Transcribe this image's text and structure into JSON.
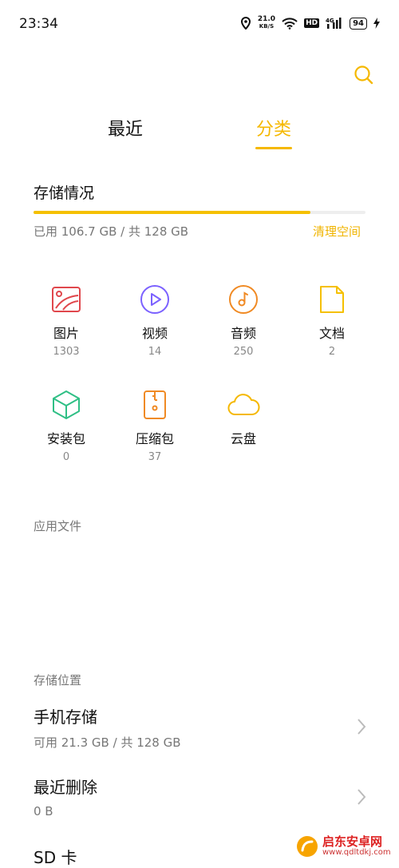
{
  "status_bar": {
    "time": "23:34",
    "speed_value": "21.0",
    "speed_unit": "KB/S",
    "hd": "HD",
    "battery": "94"
  },
  "header": {
    "tabs": [
      {
        "label": "最近"
      },
      {
        "label": "分类"
      }
    ],
    "accent_color": "#f5b800"
  },
  "storage": {
    "title": "存储情况",
    "usage_text": "已用 106.7 GB / 共 128 GB",
    "used_fraction": 0.834,
    "clean_label": "清理空间"
  },
  "categories": [
    {
      "label": "图片",
      "count": "1303",
      "icon": "image-icon",
      "color": "#e0474c"
    },
    {
      "label": "视频",
      "count": "14",
      "icon": "video-icon",
      "color": "#7b61ff"
    },
    {
      "label": "音频",
      "count": "250",
      "icon": "audio-icon",
      "color": "#f08a24"
    },
    {
      "label": "文档",
      "count": "2",
      "icon": "document-icon",
      "color": "#f5c000"
    },
    {
      "label": "安装包",
      "count": "0",
      "icon": "package-icon",
      "color": "#2fbf85"
    },
    {
      "label": "压缩包",
      "count": "37",
      "icon": "archive-icon",
      "color": "#f08a24"
    },
    {
      "label": "云盘",
      "count": "",
      "icon": "cloud-icon",
      "color": "#f5b800"
    }
  ],
  "app_files": {
    "title": "应用文件"
  },
  "storage_locations": {
    "title": "存储位置",
    "items": [
      {
        "title": "手机存储",
        "subtitle": "可用 21.3 GB / 共 128 GB"
      },
      {
        "title": "最近删除",
        "subtitle": "0 B"
      },
      {
        "title": "SD 卡"
      }
    ]
  },
  "watermark": {
    "text": "启东安卓网",
    "url": "www.qdltdkj.com"
  }
}
